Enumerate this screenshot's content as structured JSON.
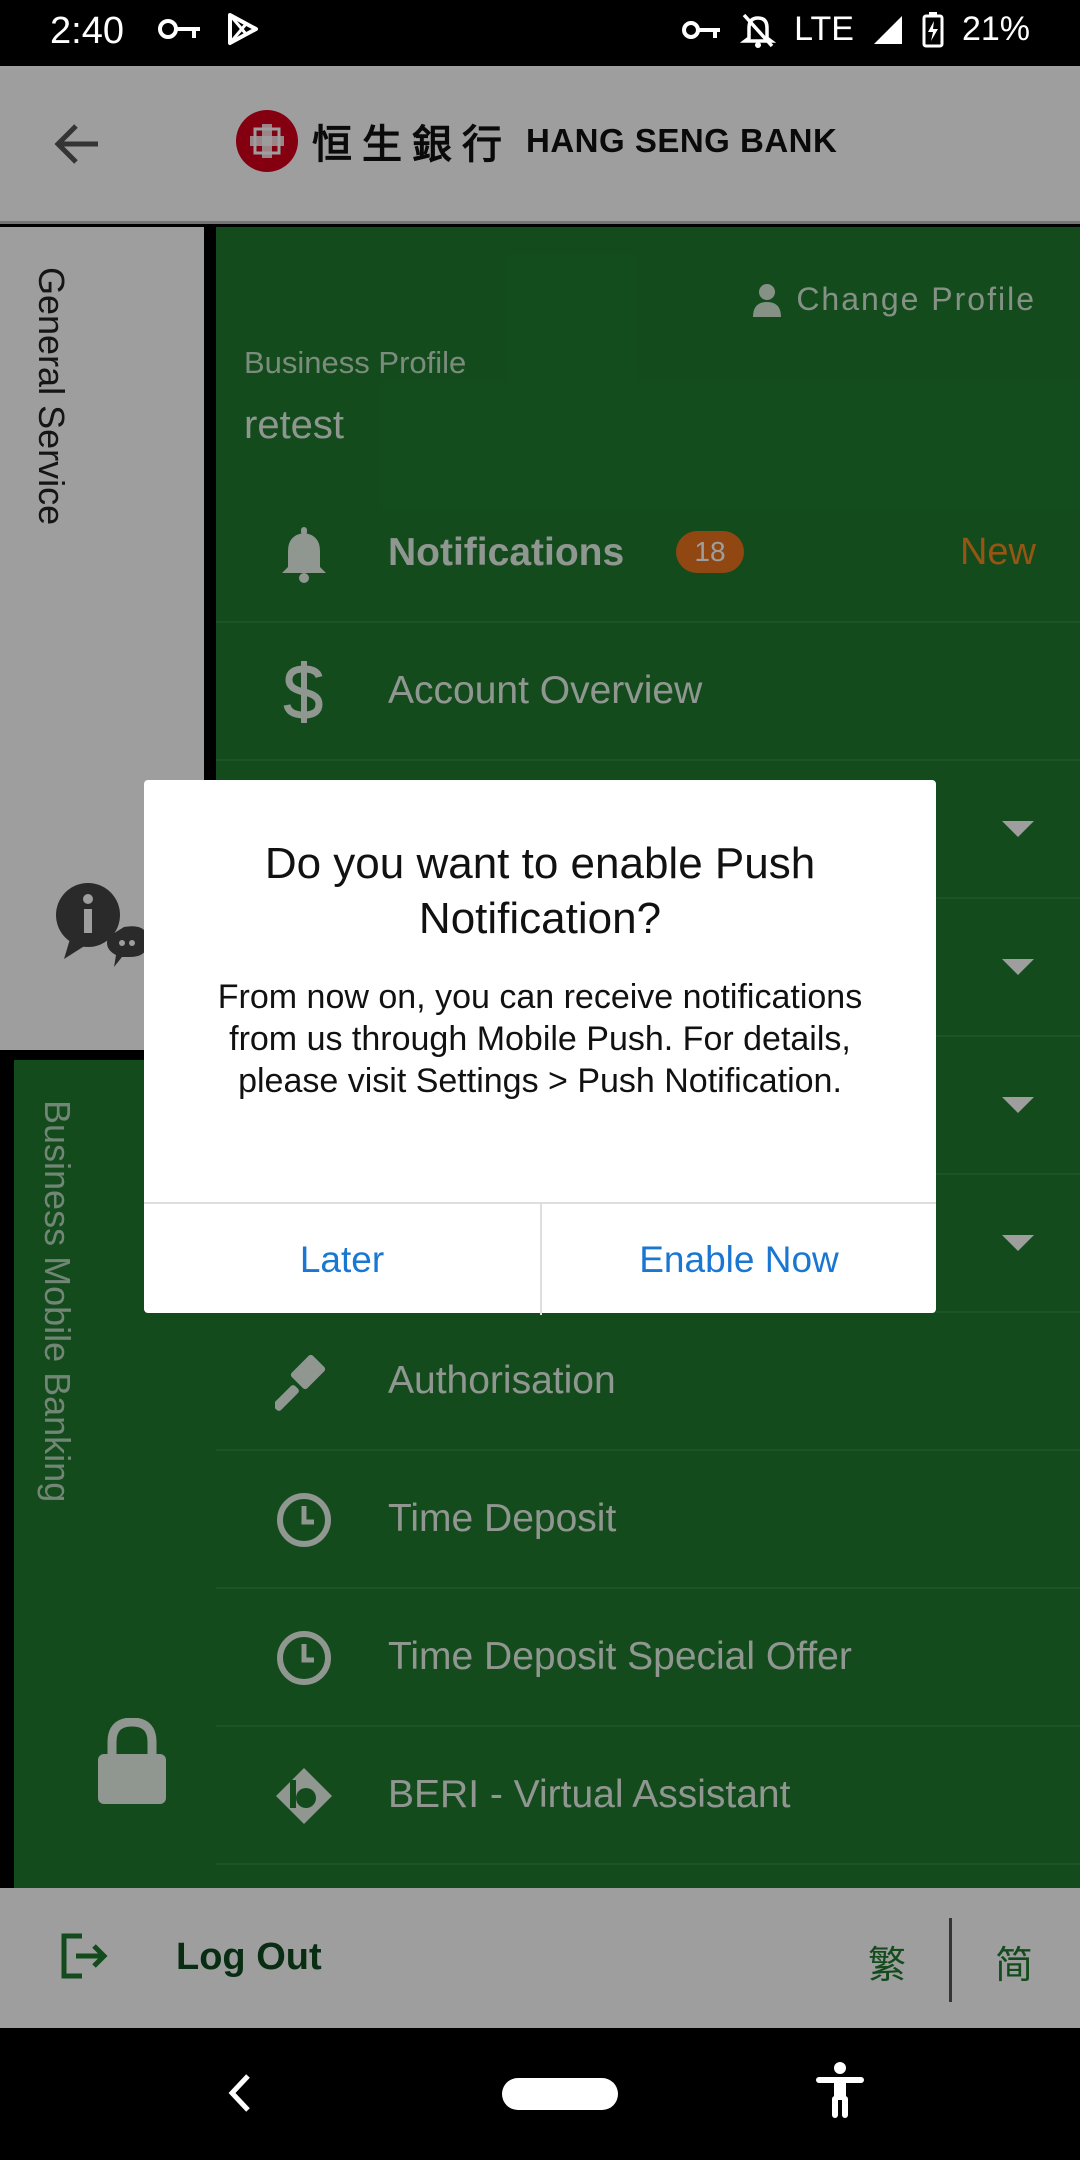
{
  "status_bar": {
    "time": "2:40",
    "network": "LTE",
    "battery": "21%"
  },
  "app_bar": {
    "logo_chinese": "恒生銀行",
    "logo_english": "HANG SENG BANK"
  },
  "side_tabs": {
    "general": "General Service",
    "business": "Business Mobile Banking"
  },
  "panel": {
    "change_profile": "Change Profile",
    "profile_label": "Business Profile",
    "profile_name": "retest",
    "menu": [
      {
        "label": "Notifications",
        "icon": "bell-icon",
        "badge": "18",
        "tag": "New"
      },
      {
        "label": "Account Overview",
        "icon": "dollar-icon"
      },
      {
        "label": "",
        "icon": "",
        "expandable": true
      },
      {
        "label": "",
        "icon": "",
        "expandable": true
      },
      {
        "label": "",
        "icon": "",
        "expandable": true
      },
      {
        "label": "",
        "icon": "",
        "expandable": true
      },
      {
        "label": "Authorisation",
        "icon": "gavel-icon"
      },
      {
        "label": "Time Deposit",
        "icon": "clock-icon"
      },
      {
        "label": "Time Deposit Special Offer",
        "icon": "clock-icon"
      },
      {
        "label": "BERI - Virtual Assistant",
        "icon": "beri-icon"
      }
    ]
  },
  "footer": {
    "logout": "Log Out",
    "lang_traditional": "繁",
    "lang_simplified": "简"
  },
  "dialog": {
    "title": "Do you want to enable Push Notification?",
    "body": "From now on, you can receive notifications from us through Mobile Push. For details, please visit Settings > Push Notification.",
    "later": "Later",
    "enable_now": "Enable Now"
  },
  "colors": {
    "brand_green": "#1f7a2f",
    "brand_red": "#d6001c",
    "badge_orange": "#e8731c",
    "link_blue": "#1976d2"
  }
}
